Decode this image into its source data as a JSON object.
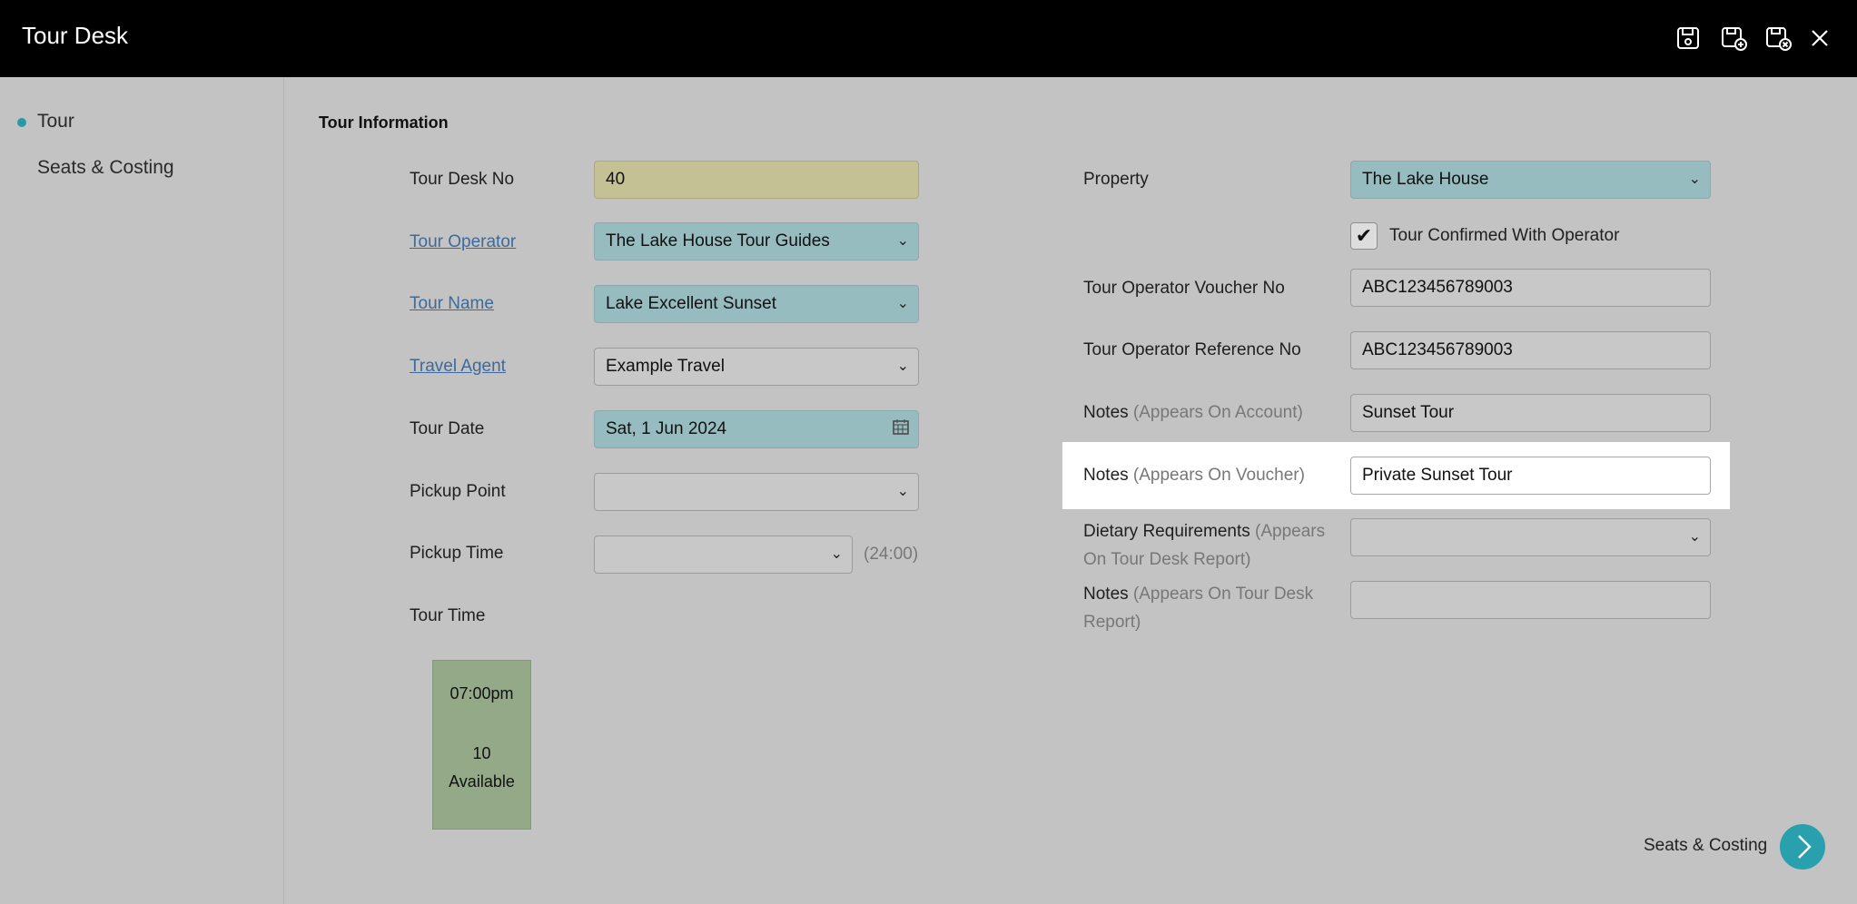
{
  "app": {
    "title": "Tour Desk"
  },
  "toolbar": {
    "save": "save-icon",
    "save_new": "save-and-new-icon",
    "save_close": "save-and-close-icon",
    "close": "close-icon"
  },
  "sidebar": {
    "items": [
      {
        "label": "Tour",
        "active": true
      },
      {
        "label": "Seats & Costing",
        "active": false
      }
    ]
  },
  "section": {
    "title": "Tour Information"
  },
  "left": {
    "tour_desk_no": {
      "label": "Tour Desk No",
      "value": "40"
    },
    "tour_operator": {
      "label": "Tour Operator",
      "value": "The Lake House Tour Guides"
    },
    "tour_name": {
      "label": "Tour Name",
      "value": "Lake Excellent Sunset"
    },
    "travel_agent": {
      "label": "Travel Agent",
      "value": "Example Travel"
    },
    "tour_date": {
      "label": "Tour Date",
      "value": "Sat, 1 Jun 2024"
    },
    "pickup_point": {
      "label": "Pickup Point",
      "value": ""
    },
    "pickup_time": {
      "label": "Pickup Time",
      "value": "",
      "format_hint": "(24:00)"
    },
    "tour_time": {
      "label": "Tour Time"
    },
    "slot": {
      "time": "07:00pm",
      "count": "10",
      "status": "Available"
    }
  },
  "right": {
    "property": {
      "label": "Property",
      "value": "The Lake House"
    },
    "confirmed": {
      "label": "Tour Confirmed With Operator",
      "checked": true
    },
    "voucher_no": {
      "label": "Tour Operator Voucher No",
      "value": "ABC123456789003"
    },
    "reference_no": {
      "label": "Tour Operator Reference No",
      "value": "ABC123456789003"
    },
    "notes_account": {
      "label": "Notes",
      "hint": "(Appears On Account)",
      "value": "Sunset Tour"
    },
    "notes_voucher": {
      "label": "Notes",
      "hint": "(Appears On Voucher)",
      "value": "Private Sunset Tour"
    },
    "dietary": {
      "label": "Dietary Requirements",
      "hint": "(Appears On Tour Desk Report)",
      "value": ""
    },
    "notes_report": {
      "label": "Notes",
      "hint": "(Appears On Tour Desk Report)",
      "value": ""
    }
  },
  "footer": {
    "next_label": "Seats & Costing"
  },
  "colors": {
    "accent": "#28a0ae",
    "teal_field": "#97bcc0",
    "yellow_field": "#c4c194",
    "slot_green": "#93a987"
  }
}
